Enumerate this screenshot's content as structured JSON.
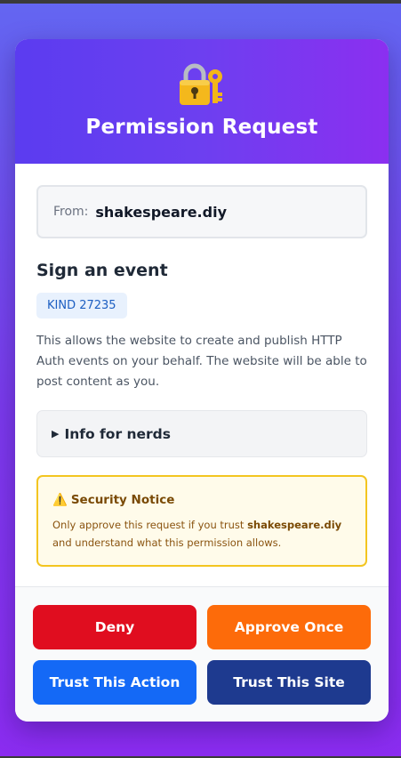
{
  "header": {
    "title": "Permission Request",
    "icon": "lock-with-key-icon"
  },
  "request": {
    "from_label": "From:",
    "from_domain": "shakespeare.diy",
    "heading": "Sign an event",
    "kind_badge": "KIND 27235",
    "description": "This allows the website to create and publish HTTP Auth events on your behalf. The website will be able to post content as you."
  },
  "nerds": {
    "label": "Info for nerds"
  },
  "notice": {
    "title": "Security Notice",
    "text_before": "Only approve this request if you trust ",
    "domain": "shakespeare.diy",
    "text_after": " and understand what this permission allows."
  },
  "buttons": {
    "deny": "Deny",
    "approve_once": "Approve Once",
    "trust_action": "Trust This Action",
    "trust_site": "Trust This Site"
  },
  "colors": {
    "deny": "#e00d1f",
    "approve_once": "#fd6b0a",
    "trust_action": "#1469f6",
    "trust_site": "#1e3a8f",
    "header_gradient_start": "#5b3cf0",
    "header_gradient_end": "#8b2ff0"
  }
}
